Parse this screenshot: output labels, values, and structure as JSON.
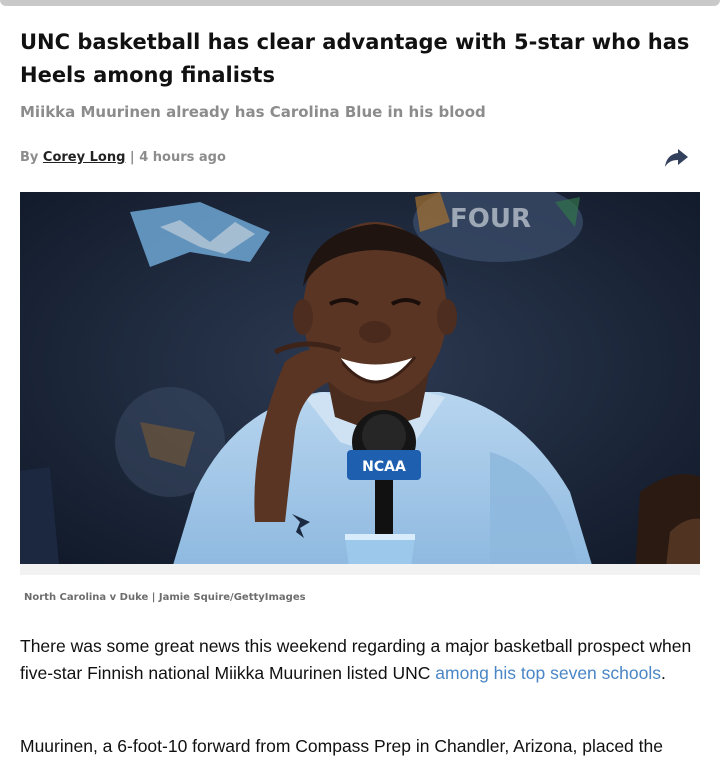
{
  "article": {
    "title": "UNC basketball has clear advantage with 5-star who has Heels among finalists",
    "subtitle": "Miikka Muurinen already has Carolina Blue in his blood",
    "byline": {
      "prefix": "By ",
      "author": "Corey Long",
      "separator": " | ",
      "time": "4 hours ago"
    },
    "share_icon": "share-arrow-icon",
    "image": {
      "credit": "North Carolina v Duke | Jamie Squire/GettyImages",
      "mic_brand": "NCAA",
      "backdrop_text": "FOUR"
    },
    "paragraphs": [
      {
        "before": "There was some great news this weekend regarding a major basketball prospect when five-star Finnish national Miikka Muurinen listed UNC ",
        "link": "among his top seven schools",
        "after": "."
      },
      {
        "text": "Muurinen, a 6-foot-10 forward from Compass Prep in Chandler, Arizona, placed the"
      }
    ]
  },
  "colors": {
    "link": "#4a86c5",
    "subtitle": "#8c8c8c",
    "share_icon": "#33415c",
    "carolina_blue": "#9cc3e6"
  }
}
